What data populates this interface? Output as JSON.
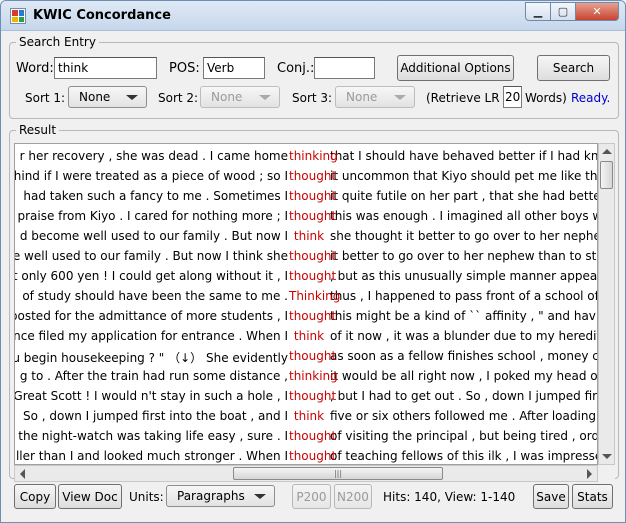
{
  "window": {
    "title": "KWIC Concordance",
    "icon": "app-grid-icon"
  },
  "search_entry": {
    "legend": "Search Entry",
    "word_label": "Word:",
    "word_value": "think",
    "pos_label": "POS:",
    "pos_value": "Verb",
    "conj_label": "Conj.:",
    "conj_value": "",
    "additional_options": "Additional Options",
    "search": "Search",
    "sort1_label": "Sort 1:",
    "sort1_value": "None",
    "sort2_label": "Sort 2:",
    "sort2_value": "None",
    "sort3_label": "Sort 3:",
    "sort3_value": "None",
    "retrieve_prefix": "(Retrieve LR",
    "retrieve_value": "20",
    "retrieve_suffix": "Words)",
    "status": "Ready."
  },
  "result": {
    "legend": "Result",
    "rows": [
      {
        "left": "r her recovery , she was dead . I came home",
        "kw": "thinking",
        "right": "that I should have behaved better if I had know"
      },
      {
        "left": "hind if I were treated as a piece of wood ; so I",
        "kw": "thought",
        "right": "it uncommon that Kiyo should pet me like that"
      },
      {
        "left": "had taken such a fancy to me . Sometimes I",
        "kw": "thought",
        "right": "it quite futile on her part , that she had better c"
      },
      {
        "left": "praise from Kiyo . I cared for nothing more ; I",
        "kw": "thought",
        "right": "this was enough . I imagined all other boys we"
      },
      {
        "left": "d become well used to our family . But now I",
        "kw": "think",
        "right": "she thought it better to go over to her nephew"
      },
      {
        "left": "e well used to our family . But now I think she",
        "kw": "thought",
        "right": "it better to go over to her nephew than to start"
      },
      {
        "left": "t only 600 yen ! I could get along without it , I",
        "kw": "thought",
        "right": ", but as this unusually simple manner appeale"
      },
      {
        "left": "of study should have been the same to me .",
        "kw": "Thinking",
        "right": "thus , I happened to pass front of a school of p"
      },
      {
        "left": "posted for the admittance of more students , I",
        "kw": "thought",
        "right": "this might be a kind of `` affinity , \" and having"
      },
      {
        "left": "nce filed my application for entrance . When I",
        "kw": "think",
        "right": "of it now , it was a blunder due to my hereditar"
      },
      {
        "left": "u begin housekeeping ? \" （↓） She evidently",
        "kw": "thought",
        "right": "as soon as a fellow finishes school , money c"
      },
      {
        "left": "g to . After the train had run some distance ,",
        "kw": "thinking",
        "right": "it would be all right now , I poked my head out"
      },
      {
        "left": "Great Scott ! I would n't stay in such a hole , I",
        "kw": "thought",
        "right": ", but I had to get out . So , down I jumped first"
      },
      {
        "left": "So , down I jumped first into the boat , and I",
        "kw": "think",
        "right": "five or six others followed me . After loading ab"
      },
      {
        "left": "the night-watch was taking life easy , sure . I",
        "kw": "thought",
        "right": "of visiting the principal , but being tired , ordere"
      },
      {
        "left": "ller than I and looked much stronger . When I",
        "kw": "thought",
        "right": "of teaching fellows of this ilk , I was impressed"
      }
    ]
  },
  "footer": {
    "copy": "Copy",
    "view_doc": "View Doc",
    "units_label": "Units:",
    "units_value": "Paragraphs",
    "p200": "P200",
    "n200": "N200",
    "hits": "Hits: 140, View: 1-140",
    "save": "Save",
    "stats": "Stats"
  },
  "colors": {
    "keyword": "#cc0000",
    "status": "#0000cc"
  }
}
